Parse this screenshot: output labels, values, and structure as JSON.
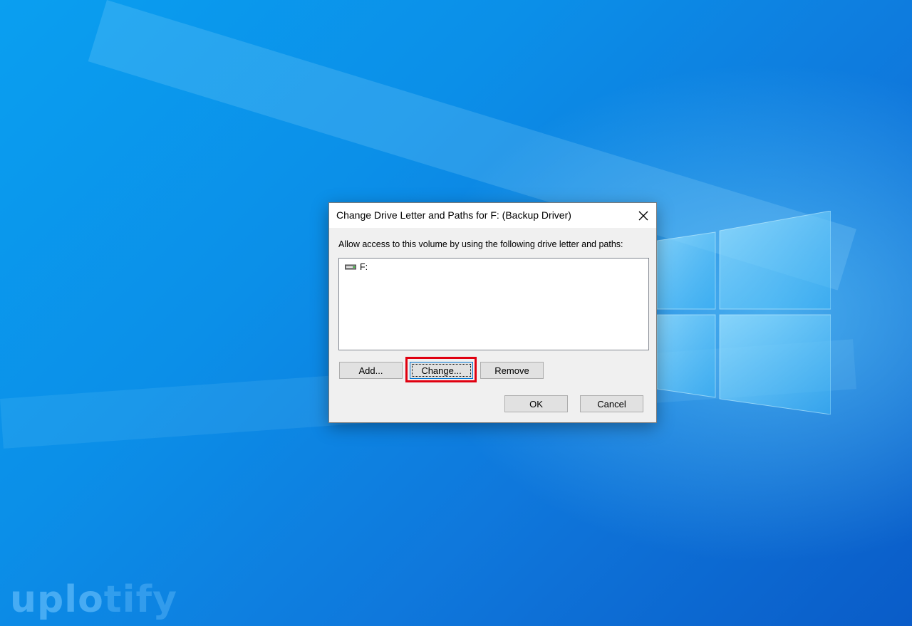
{
  "desktop": {
    "watermark": {
      "part1": "uplo",
      "part2": "tify"
    }
  },
  "dialog": {
    "title": "Change Drive Letter and Paths for F: (Backup Driver)",
    "instruction": "Allow access to this volume by using the following drive letter and paths:",
    "list_items": [
      {
        "label": "F:",
        "icon": "drive-icon"
      }
    ],
    "buttons": {
      "add": "Add...",
      "change": "Change...",
      "remove": "Remove",
      "ok": "OK",
      "cancel": "Cancel"
    },
    "focused_button": "change",
    "highlight_color": "#e00010"
  }
}
